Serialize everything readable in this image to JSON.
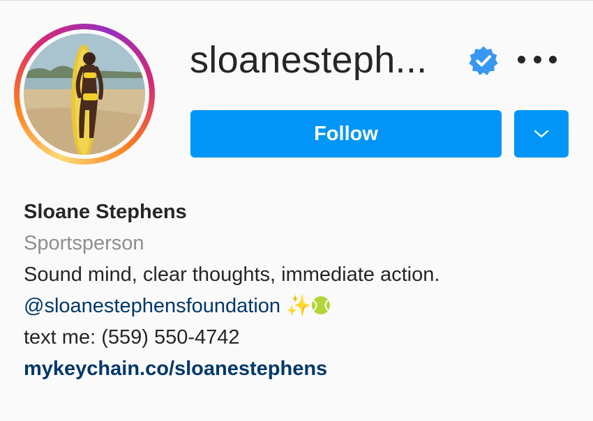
{
  "profile": {
    "username": "sloanesteph...",
    "verified": true,
    "more_options_icon": "more-horizontal-icon",
    "follow_label": "Follow",
    "dropdown_icon": "chevron-down-icon",
    "avatar_icon": "profile-photo-with-story-ring"
  },
  "bio": {
    "full_name": "Sloane Stephens",
    "category": "Sportsperson",
    "text": "Sound mind, clear thoughts, immediate action.",
    "mention": "@sloanestephensfoundation",
    "mention_emoji_sparkles": "✨",
    "mention_emoji_tennis": "tennis-ball-emoji",
    "phone_line": "text me: (559) 550-4742",
    "link": "mykeychain.co/sloanestephens"
  },
  "colors": {
    "follow_button": "#0095f6",
    "link_text": "#00376b",
    "category_text": "#8e8e8e",
    "verified_badge": "#3897f0",
    "primary_text": "#262626"
  }
}
